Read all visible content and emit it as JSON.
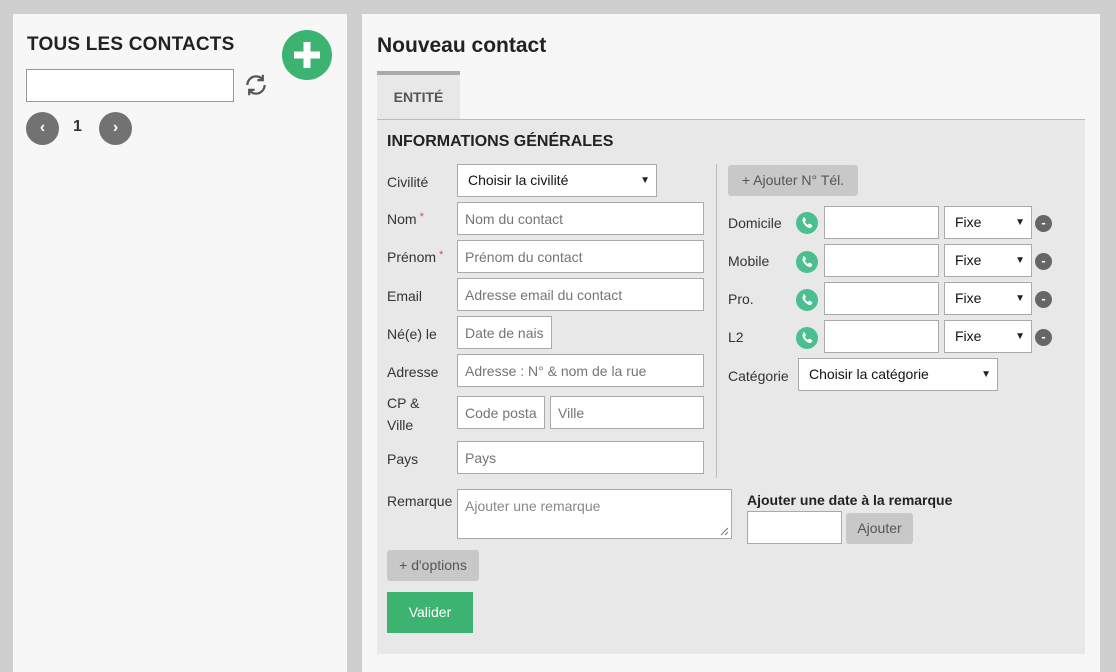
{
  "sidebar": {
    "title": "TOUS LES CONTACTS",
    "search_value": "",
    "prev_label": "‹",
    "next_label": "›",
    "page_number": "1"
  },
  "main": {
    "title": "Nouveau contact",
    "tab_label": "ENTITÉ",
    "section_title": "INFORMATIONS GÉNÉRALES",
    "fields": {
      "civilite_label": "Civilité",
      "civilite_value": "Choisir la civilité",
      "nom_label": "Nom",
      "nom_placeholder": "Nom du contact",
      "prenom_label": "Prénom",
      "prenom_placeholder": "Prénom du contact",
      "email_label": "Email",
      "email_placeholder": "Adresse email du contact",
      "naissance_label": "Né(e) le",
      "naissance_placeholder": "Date de nais:",
      "adresse_label": "Adresse",
      "adresse_placeholder": "Adresse : N° & nom de la rue",
      "cpville_label_1": "CP &",
      "cpville_label_2": "Ville",
      "cp_placeholder": "Code posta",
      "ville_placeholder": "Ville",
      "pays_label": "Pays",
      "pays_placeholder": "Pays",
      "required_mark": "*"
    },
    "phones": {
      "add_label": "+ Ajouter N° Tél.",
      "rows": [
        {
          "label": "Domicile",
          "type": "Fixe"
        },
        {
          "label": "Mobile",
          "type": "Fixe"
        },
        {
          "label": "Pro.",
          "type": "Fixe"
        },
        {
          "label": "L2",
          "type": "Fixe"
        }
      ],
      "minus_label": "-",
      "categorie_label": "Catégorie",
      "categorie_value": "Choisir la catégorie"
    },
    "remarque": {
      "label": "Remarque",
      "placeholder": "Ajouter une remarque",
      "date_title": "Ajouter une date à la remarque",
      "ajouter_label": "Ajouter"
    },
    "options_label": "+ d'options",
    "valider_label": "Valider"
  },
  "colors": {
    "accent_green": "#3cb371",
    "phone_green": "#4cbf8f",
    "required_red": "#e14b4b"
  },
  "icons": [
    "plus-icon",
    "refresh-icon",
    "phone-icon",
    "minus-icon",
    "caret-down-icon"
  ]
}
